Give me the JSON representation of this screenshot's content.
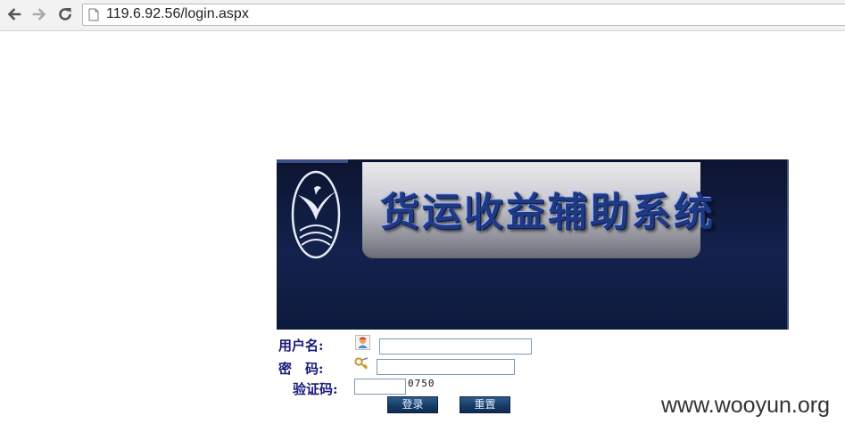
{
  "browser": {
    "url": "119.6.92.56/login.aspx",
    "back_icon": "arrow-left-icon",
    "forward_icon": "arrow-right-icon",
    "reload_icon": "reload-icon",
    "page_icon": "page-icon"
  },
  "banner": {
    "title": "货运收益辅助系统",
    "logo": "bird-logo"
  },
  "login": {
    "username_label": "用户名:",
    "password_label": "密　码:",
    "captcha_label": "验证码:",
    "username_value": "",
    "password_value": "",
    "captcha_value": "",
    "captcha_code": "0750",
    "login_button": "登录",
    "reset_button": "重置"
  },
  "watermark": "www.wooyun.org"
}
